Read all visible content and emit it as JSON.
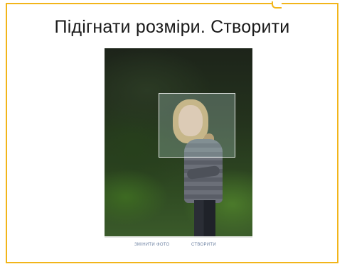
{
  "caption": "Підігнати розміри. Створити",
  "toolbar": {
    "change_photo_label": "ЗМІНИТИ ФОТО",
    "create_label": "СТВОРИТИ"
  },
  "colors": {
    "frame_border": "#f2b51a",
    "toolbar_text": "#6a7fa0"
  }
}
